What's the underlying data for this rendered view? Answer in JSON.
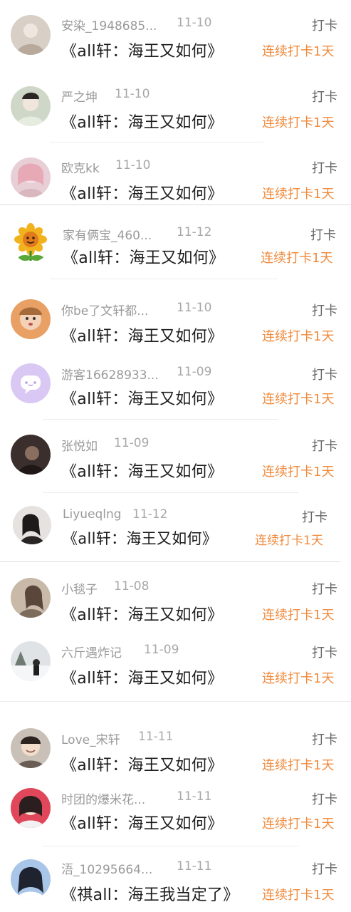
{
  "checkins": [
    {
      "user": "安染_1948685...",
      "date": "11-10",
      "type": "打卡",
      "book": "《all轩：海王又如何》",
      "streak": "连续打卡1天",
      "avatar_color": "#d8cfc6",
      "avatar_icon": "person-photo-avatar"
    },
    {
      "user": "严之坤",
      "date": "11-10",
      "type": "打卡",
      "book": "《all轩：海王又如何》",
      "streak": "连续打卡1天",
      "avatar_color": "#cfd8c8",
      "avatar_icon": "person-photo-avatar"
    },
    {
      "user": "欧克kk",
      "date": "11-10",
      "type": "打卡",
      "book": "《all轩：海王又如何》",
      "streak": "连续打卡1天",
      "avatar_color": "#e8cfd6",
      "avatar_icon": "anime-photo-avatar"
    },
    {
      "user": "家有俩宝_460...",
      "date": "11-12",
      "type": "打卡",
      "book": "《all轩：海王又如何》",
      "streak": "连续打卡1天",
      "avatar_color": "#ffffff",
      "avatar_icon": "sunflower-avatar"
    },
    {
      "user": "你be了文轩都...",
      "date": "11-10",
      "type": "打卡",
      "book": "《all轩：海王又如何》",
      "streak": "连续打卡1天",
      "avatar_color": "#e9a064",
      "avatar_icon": "person-photo-avatar"
    },
    {
      "user": "游客16628933...",
      "date": "11-09",
      "type": "打卡",
      "book": "《all轩：海王又如何》",
      "streak": "连续打卡1天",
      "avatar_color": "#d9c8f3",
      "avatar_icon": "chat-bubble-avatar"
    },
    {
      "user": "张悦如",
      "date": "11-09",
      "type": "打卡",
      "book": "《all轩：海王又如何》",
      "streak": "连续打卡1天",
      "avatar_color": "#3a2f2c",
      "avatar_icon": "person-photo-avatar"
    },
    {
      "user": "Liyueqlng",
      "date": "11-12",
      "type": "打卡",
      "book": "《all轩：海王又如何》",
      "streak": "连续打卡1天",
      "avatar_color": "#e6e2e0",
      "avatar_icon": "person-photo-avatar"
    },
    {
      "user": "小毯子",
      "date": "11-08",
      "type": "打卡",
      "book": "《all轩：海王又如何》",
      "streak": "连续打卡1天",
      "avatar_color": "#c8b9a8",
      "avatar_icon": "person-photo-avatar"
    },
    {
      "user": "六斤遇炸记",
      "date": "11-09",
      "type": "打卡",
      "book": "《all轩：海王又如何》",
      "streak": "连续打卡1天",
      "avatar_color": "#dfe3e6",
      "avatar_icon": "snow-photo-avatar"
    },
    {
      "user": "Love_宋轩",
      "date": "11-11",
      "type": "打卡",
      "book": "《all轩：海王又如何》",
      "streak": "连续打卡1天",
      "avatar_color": "#c9c1b8",
      "avatar_icon": "person-photo-avatar"
    },
    {
      "user": "时团的爆米花...",
      "date": "11-11",
      "type": "打卡",
      "book": "《all轩：海王又如何》",
      "streak": "连续打卡1天",
      "avatar_color": "#e0475a",
      "avatar_icon": "person-photo-avatar"
    },
    {
      "user": "浯_10295664...",
      "date": "11-11",
      "type": "打卡",
      "book": "《祺all：海王我当定了》",
      "streak": "连续打卡1天",
      "avatar_color": "#a9c6e8",
      "avatar_icon": "person-photo-avatar"
    }
  ]
}
